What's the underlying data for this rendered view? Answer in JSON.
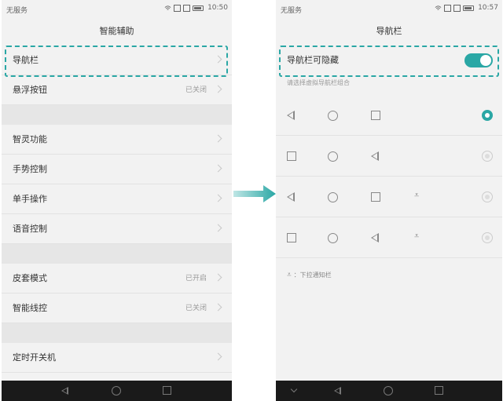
{
  "left": {
    "status": {
      "carrier": "无服务",
      "time": "10:50"
    },
    "title": "智能辅助",
    "items": [
      {
        "label": "导航栏",
        "state": ""
      },
      {
        "label": "悬浮按钮",
        "state": "已关闭"
      },
      {
        "label": "智灵功能",
        "state": ""
      },
      {
        "label": "手势控制",
        "state": ""
      },
      {
        "label": "单手操作",
        "state": ""
      },
      {
        "label": "语音控制",
        "state": ""
      },
      {
        "label": "皮套模式",
        "state": "已开启"
      },
      {
        "label": "智能线控",
        "state": "已关闭"
      },
      {
        "label": "定时开关机",
        "state": ""
      }
    ]
  },
  "right": {
    "status": {
      "carrier": "无服务",
      "time": "10:57"
    },
    "title": "导航栏",
    "toggle_label": "导航栏可隐藏",
    "toggle_on": true,
    "subhead": "请选择虚拟导航栏组合",
    "combos": [
      {
        "keys": [
          "back",
          "home",
          "recent"
        ],
        "selected": true
      },
      {
        "keys": [
          "recent",
          "home",
          "back"
        ],
        "selected": false
      },
      {
        "keys": [
          "back",
          "home",
          "recent",
          "notification"
        ],
        "selected": false
      },
      {
        "keys": [
          "recent",
          "home",
          "back",
          "notification"
        ],
        "selected": false
      }
    ],
    "legend_icon": "⩡",
    "legend_text": "：下拉通知栏"
  },
  "colors": {
    "accent": "#2aa7a5",
    "navbar": "#1a1a1a",
    "background": "#f2f2f2"
  },
  "icons": [
    "back-icon",
    "home-icon",
    "recent-apps-icon",
    "notification-pull-icon",
    "chevron-right-icon",
    "wifi-icon",
    "battery-icon"
  ]
}
